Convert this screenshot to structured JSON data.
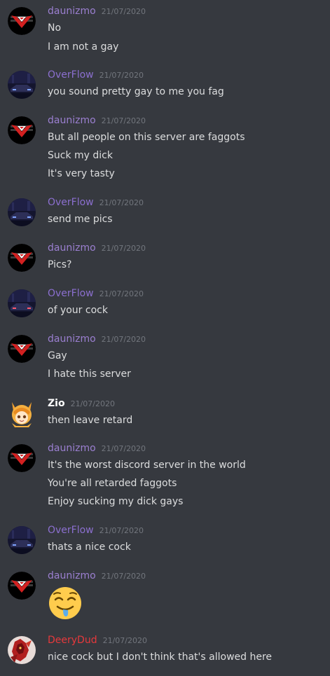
{
  "colors": {
    "background": "#36393f",
    "daunizmo_name": "#9b7fd0",
    "overflow_name": "#8b6fcf",
    "zio_name": "#ffffff",
    "deerydud_name": "#e6393c",
    "message_text": "#dcddde",
    "timestamp": "#72767d"
  },
  "messages": [
    {
      "user": "daunizmo",
      "avatar": "red-eagle-avatar",
      "time": "21/07/2020",
      "lines": [
        "No",
        "I am not a gay"
      ]
    },
    {
      "user": "OverFlow",
      "avatar": "night-car-avatar",
      "time": "21/07/2020",
      "lines": [
        "you sound pretty gay to me you fag"
      ]
    },
    {
      "user": "daunizmo",
      "avatar": "red-eagle-avatar",
      "time": "21/07/2020",
      "lines": [
        "But all people on this server are faggots",
        "Suck my dick",
        "It's very tasty"
      ]
    },
    {
      "user": "OverFlow",
      "avatar": "night-car-avatar",
      "time": "21/07/2020",
      "lines": [
        "send me pics"
      ]
    },
    {
      "user": "daunizmo",
      "avatar": "red-eagle-avatar",
      "time": "21/07/2020",
      "lines": [
        "Pics?"
      ]
    },
    {
      "user": "OverFlow",
      "avatar": "night-car-avatar",
      "time": "21/07/2020",
      "lines": [
        "of your cock"
      ]
    },
    {
      "user": "daunizmo",
      "avatar": "red-eagle-avatar",
      "time": "21/07/2020",
      "lines": [
        "Gay",
        "I hate this server"
      ]
    },
    {
      "user": "Zio",
      "avatar": "anime-fox-avatar",
      "time": "21/07/2020",
      "lines": [
        "then leave retard"
      ]
    },
    {
      "user": "daunizmo",
      "avatar": "red-eagle-avatar",
      "time": "21/07/2020",
      "lines": [
        "It's the worst discord server in the world",
        "You're all retarded faggots",
        "Enjoy sucking my dick gays"
      ]
    },
    {
      "user": "OverFlow",
      "avatar": "night-car-avatar",
      "time": "21/07/2020",
      "lines": [
        "thats a nice cock"
      ]
    },
    {
      "user": "daunizmo",
      "avatar": "red-eagle-avatar",
      "time": "21/07/2020",
      "emoji": "drooling-face-emoji"
    },
    {
      "user": "DeeryDud",
      "avatar": "red-dragon-avatar",
      "time": "21/07/2020",
      "lines": [
        "nice cock but I don't think that's allowed here"
      ]
    }
  ]
}
